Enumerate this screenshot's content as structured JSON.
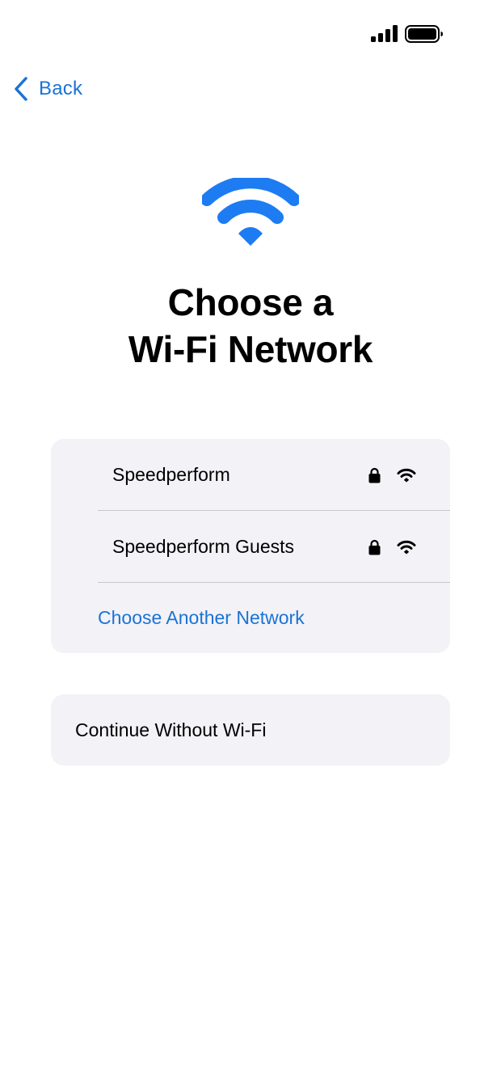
{
  "status_bar": {
    "signal_icon": "cellular-signal-icon",
    "battery_icon": "battery-icon"
  },
  "nav": {
    "back_label": "Back",
    "back_icon": "chevron-left-icon"
  },
  "hero": {
    "icon": "wifi-icon",
    "title": "Choose a\nWi-Fi Network"
  },
  "networks": [
    {
      "name": "Speedperform",
      "secured": true,
      "signal_bars": 3
    },
    {
      "name": "Speedperform Guests",
      "secured": true,
      "signal_bars": 3
    }
  ],
  "other_network_label": "Choose Another Network",
  "continue_label": "Continue Without Wi-Fi",
  "colors": {
    "accent": "#1a73d6",
    "wifi_hero": "#1e7cf2",
    "card_background": "#f2f2f7",
    "separator": "#c8c8cc"
  }
}
